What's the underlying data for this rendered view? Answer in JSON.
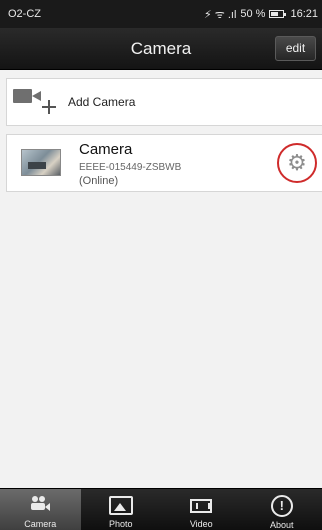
{
  "status_bar": {
    "carrier": "O2-CZ",
    "signal_glyphs": "⚡ ᯤ .ıl",
    "battery_percent": "50 %",
    "time": "16:21"
  },
  "header": {
    "title": "Camera",
    "edit_label": "edit"
  },
  "main": {
    "add_camera_label": "Add Camera",
    "camera": {
      "name": "Camera",
      "id": "EEEE-015449-ZSBWB",
      "status": "(Online)"
    }
  },
  "bottom_nav": {
    "tabs": [
      {
        "label": "Camera",
        "icon": "camera-users-icon",
        "active": true
      },
      {
        "label": "Photo",
        "icon": "photo-icon",
        "active": false
      },
      {
        "label": "Video",
        "icon": "video-icon",
        "active": false
      },
      {
        "label": "About",
        "icon": "alert-icon",
        "active": false
      }
    ]
  },
  "colors": {
    "highlight_circle": "#cf2b2b",
    "header_bg": "#1a1a1a",
    "active_tab_bg": "#5a5a5a"
  }
}
